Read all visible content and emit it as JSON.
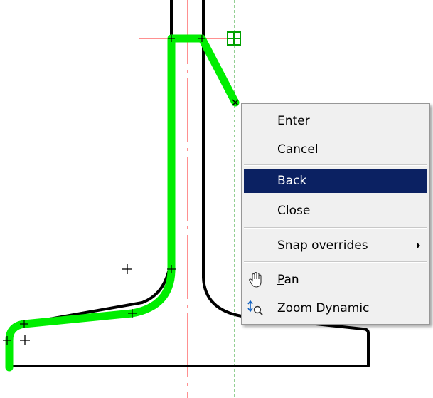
{
  "menu": {
    "items": [
      {
        "label": "Enter"
      },
      {
        "label": "Cancel"
      },
      {
        "label": "Back",
        "selected": true
      },
      {
        "label": "Close"
      },
      {
        "label": "Snap overrides",
        "submenu": true
      },
      {
        "label_first": "P",
        "label_rest": "an",
        "icon": "pan-hand-icon"
      },
      {
        "label_first": "Z",
        "label_rest": "oom Dynamic",
        "icon": "zoom-dynamic-icon"
      }
    ]
  },
  "colors": {
    "highlight": "#00ee00",
    "outline": "#000000",
    "centerline": "#ff0000",
    "snap_guide": "#00aa00",
    "menu_selected": "#0b2162"
  }
}
